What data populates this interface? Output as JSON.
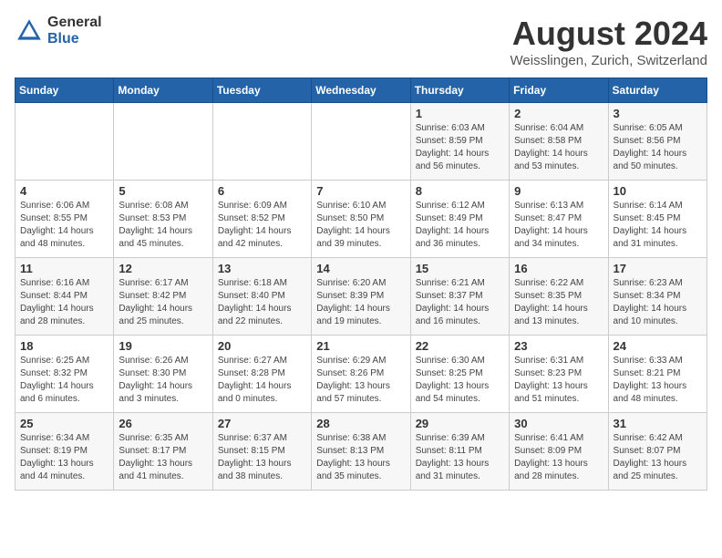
{
  "header": {
    "logo_general": "General",
    "logo_blue": "Blue",
    "month_title": "August 2024",
    "location": "Weisslingen, Zurich, Switzerland"
  },
  "weekdays": [
    "Sunday",
    "Monday",
    "Tuesday",
    "Wednesday",
    "Thursday",
    "Friday",
    "Saturday"
  ],
  "weeks": [
    [
      {
        "day": "",
        "info": ""
      },
      {
        "day": "",
        "info": ""
      },
      {
        "day": "",
        "info": ""
      },
      {
        "day": "",
        "info": ""
      },
      {
        "day": "1",
        "info": "Sunrise: 6:03 AM\nSunset: 8:59 PM\nDaylight: 14 hours\nand 56 minutes."
      },
      {
        "day": "2",
        "info": "Sunrise: 6:04 AM\nSunset: 8:58 PM\nDaylight: 14 hours\nand 53 minutes."
      },
      {
        "day": "3",
        "info": "Sunrise: 6:05 AM\nSunset: 8:56 PM\nDaylight: 14 hours\nand 50 minutes."
      }
    ],
    [
      {
        "day": "4",
        "info": "Sunrise: 6:06 AM\nSunset: 8:55 PM\nDaylight: 14 hours\nand 48 minutes."
      },
      {
        "day": "5",
        "info": "Sunrise: 6:08 AM\nSunset: 8:53 PM\nDaylight: 14 hours\nand 45 minutes."
      },
      {
        "day": "6",
        "info": "Sunrise: 6:09 AM\nSunset: 8:52 PM\nDaylight: 14 hours\nand 42 minutes."
      },
      {
        "day": "7",
        "info": "Sunrise: 6:10 AM\nSunset: 8:50 PM\nDaylight: 14 hours\nand 39 minutes."
      },
      {
        "day": "8",
        "info": "Sunrise: 6:12 AM\nSunset: 8:49 PM\nDaylight: 14 hours\nand 36 minutes."
      },
      {
        "day": "9",
        "info": "Sunrise: 6:13 AM\nSunset: 8:47 PM\nDaylight: 14 hours\nand 34 minutes."
      },
      {
        "day": "10",
        "info": "Sunrise: 6:14 AM\nSunset: 8:45 PM\nDaylight: 14 hours\nand 31 minutes."
      }
    ],
    [
      {
        "day": "11",
        "info": "Sunrise: 6:16 AM\nSunset: 8:44 PM\nDaylight: 14 hours\nand 28 minutes."
      },
      {
        "day": "12",
        "info": "Sunrise: 6:17 AM\nSunset: 8:42 PM\nDaylight: 14 hours\nand 25 minutes."
      },
      {
        "day": "13",
        "info": "Sunrise: 6:18 AM\nSunset: 8:40 PM\nDaylight: 14 hours\nand 22 minutes."
      },
      {
        "day": "14",
        "info": "Sunrise: 6:20 AM\nSunset: 8:39 PM\nDaylight: 14 hours\nand 19 minutes."
      },
      {
        "day": "15",
        "info": "Sunrise: 6:21 AM\nSunset: 8:37 PM\nDaylight: 14 hours\nand 16 minutes."
      },
      {
        "day": "16",
        "info": "Sunrise: 6:22 AM\nSunset: 8:35 PM\nDaylight: 14 hours\nand 13 minutes."
      },
      {
        "day": "17",
        "info": "Sunrise: 6:23 AM\nSunset: 8:34 PM\nDaylight: 14 hours\nand 10 minutes."
      }
    ],
    [
      {
        "day": "18",
        "info": "Sunrise: 6:25 AM\nSunset: 8:32 PM\nDaylight: 14 hours\nand 6 minutes."
      },
      {
        "day": "19",
        "info": "Sunrise: 6:26 AM\nSunset: 8:30 PM\nDaylight: 14 hours\nand 3 minutes."
      },
      {
        "day": "20",
        "info": "Sunrise: 6:27 AM\nSunset: 8:28 PM\nDaylight: 14 hours\nand 0 minutes."
      },
      {
        "day": "21",
        "info": "Sunrise: 6:29 AM\nSunset: 8:26 PM\nDaylight: 13 hours\nand 57 minutes."
      },
      {
        "day": "22",
        "info": "Sunrise: 6:30 AM\nSunset: 8:25 PM\nDaylight: 13 hours\nand 54 minutes."
      },
      {
        "day": "23",
        "info": "Sunrise: 6:31 AM\nSunset: 8:23 PM\nDaylight: 13 hours\nand 51 minutes."
      },
      {
        "day": "24",
        "info": "Sunrise: 6:33 AM\nSunset: 8:21 PM\nDaylight: 13 hours\nand 48 minutes."
      }
    ],
    [
      {
        "day": "25",
        "info": "Sunrise: 6:34 AM\nSunset: 8:19 PM\nDaylight: 13 hours\nand 44 minutes."
      },
      {
        "day": "26",
        "info": "Sunrise: 6:35 AM\nSunset: 8:17 PM\nDaylight: 13 hours\nand 41 minutes."
      },
      {
        "day": "27",
        "info": "Sunrise: 6:37 AM\nSunset: 8:15 PM\nDaylight: 13 hours\nand 38 minutes."
      },
      {
        "day": "28",
        "info": "Sunrise: 6:38 AM\nSunset: 8:13 PM\nDaylight: 13 hours\nand 35 minutes."
      },
      {
        "day": "29",
        "info": "Sunrise: 6:39 AM\nSunset: 8:11 PM\nDaylight: 13 hours\nand 31 minutes."
      },
      {
        "day": "30",
        "info": "Sunrise: 6:41 AM\nSunset: 8:09 PM\nDaylight: 13 hours\nand 28 minutes."
      },
      {
        "day": "31",
        "info": "Sunrise: 6:42 AM\nSunset: 8:07 PM\nDaylight: 13 hours\nand 25 minutes."
      }
    ]
  ]
}
